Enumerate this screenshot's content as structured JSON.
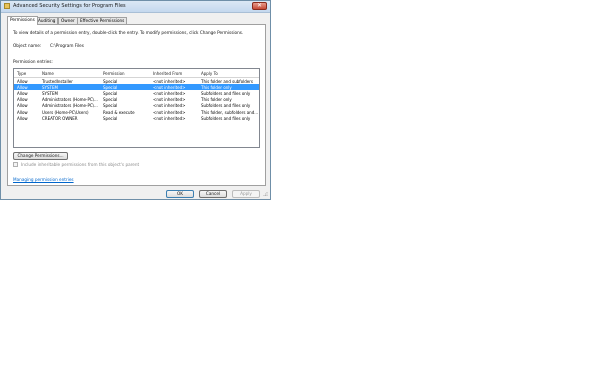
{
  "window": {
    "title": "Advanced Security Settings for Program Files",
    "close_glyph": "✕"
  },
  "tabs": [
    {
      "label": "Permissions",
      "active": true
    },
    {
      "label": "Auditing",
      "active": false
    },
    {
      "label": "Owner",
      "active": false
    },
    {
      "label": "Effective Permissions",
      "active": false
    }
  ],
  "permissions": {
    "instructions": "To view details of a permission entry, double-click the entry. To modify permissions, click Change Permissions.",
    "object_name_label": "Object name:",
    "object_name_value": "C:\\Program Files",
    "entries_label": "Permission entries:",
    "columns": [
      "Type",
      "Name",
      "Permission",
      "Inherited From",
      "Apply To"
    ],
    "entries": [
      {
        "type": "Allow",
        "name": "TrustedInstaller",
        "permission": "Special",
        "inherited_from": "<not inherited>",
        "apply_to": "This folder and subfolders",
        "selected": false
      },
      {
        "type": "Allow",
        "name": "SYSTEM",
        "permission": "Special",
        "inherited_from": "<not inherited>",
        "apply_to": "This folder only",
        "selected": true
      },
      {
        "type": "Allow",
        "name": "SYSTEM",
        "permission": "Special",
        "inherited_from": "<not inherited>",
        "apply_to": "Subfolders and files only",
        "selected": false
      },
      {
        "type": "Allow",
        "name": "Administrators (Home-PC\\...",
        "permission": "Special",
        "inherited_from": "<not inherited>",
        "apply_to": "This folder only",
        "selected": false
      },
      {
        "type": "Allow",
        "name": "Administrators (Home-PC\\...",
        "permission": "Special",
        "inherited_from": "<not inherited>",
        "apply_to": "Subfolders and files only",
        "selected": false
      },
      {
        "type": "Allow",
        "name": "Users (Home-PC\\Users)",
        "permission": "Read & execute",
        "inherited_from": "<not inherited>",
        "apply_to": "This folder, subfolders and...",
        "selected": false
      },
      {
        "type": "Allow",
        "name": "CREATOR OWNER",
        "permission": "Special",
        "inherited_from": "<not inherited>",
        "apply_to": "Subfolders and files only",
        "selected": false
      }
    ],
    "change_permissions_button": "Change Permissions...",
    "include_inheritable_label": "Include inheritable permissions from this object's parent",
    "include_inheritable_checked": false,
    "managing_link": "Managing permission entries"
  },
  "footer": {
    "ok": "OK",
    "cancel": "Cancel",
    "apply": "Apply"
  },
  "colors": {
    "selection": "#3399ff",
    "link": "#0066cc",
    "frame": "#f0f0f0"
  }
}
